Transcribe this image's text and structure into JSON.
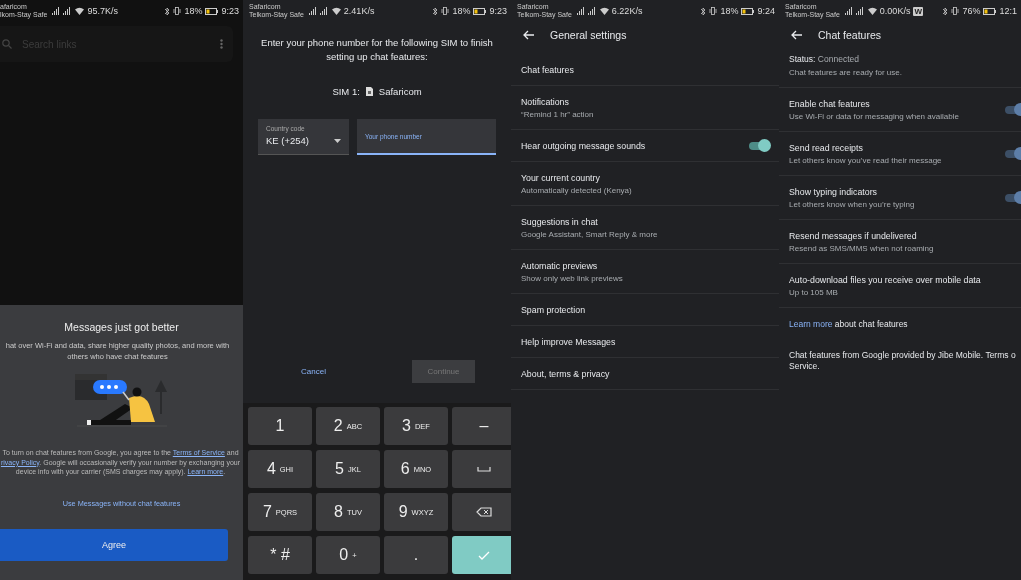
{
  "panels": [
    {
      "kind": "promo",
      "status": {
        "carrier_1": "afaricom",
        "carrier_2": "lkom-Stay Safe",
        "speed": "95.7K/s",
        "battery": "18%",
        "time": "9:23"
      },
      "search": {
        "placeholder": "Search links"
      },
      "sheet": {
        "title": "Messages just got better",
        "subtitle": "hat over Wi-Fi and data, share higher quality photos, and more with others who have chat features",
        "legal": [
          {
            "text": "To turn on chat features from Google, you agree to the ",
            "link": false
          },
          {
            "text": "Terms of Service",
            "link": true
          },
          {
            "text": " and ",
            "link": false
          },
          {
            "text": "rivacy Policy",
            "link": true
          },
          {
            "text": ". Google will occasionally verify your number by exchanging your device info with your carrier (SMS charges may apply). ",
            "link": false
          },
          {
            "text": "Learn more",
            "link": true
          },
          {
            "text": ".",
            "link": false
          }
        ],
        "secondary_button": "Use Messages without chat features",
        "primary_button": "Agree"
      }
    },
    {
      "kind": "verify",
      "status": {
        "carrier_1": "Safaricom",
        "carrier_2": "Telkom-Stay Safe",
        "speed": "2.41K/s",
        "battery": "18%",
        "time": "9:23"
      },
      "prompt": "Enter your phone number for the following SIM to finish setting up chat features:",
      "sim_label": "SIM 1:",
      "sim_name": "Safaricom",
      "country_field": {
        "label": "Country code",
        "value": "KE (+254)"
      },
      "phone_field": {
        "label": "Your phone number",
        "focused": true
      },
      "buttons": [
        {
          "label": "Cancel",
          "disabled": false
        },
        {
          "label": "Continue",
          "disabled": true
        }
      ],
      "keypad": [
        {
          "kind": "digit",
          "label": "1"
        },
        {
          "kind": "digit",
          "label": "2",
          "letters": "ABC"
        },
        {
          "kind": "digit",
          "label": "3",
          "letters": "DEF"
        },
        {
          "kind": "digit",
          "label": "–"
        },
        {
          "kind": "digit",
          "label": "4",
          "letters": "GHI"
        },
        {
          "kind": "digit",
          "label": "5",
          "letters": "JKL"
        },
        {
          "kind": "digit",
          "label": "6",
          "letters": "MNO"
        },
        {
          "kind": "space"
        },
        {
          "kind": "digit",
          "label": "7",
          "letters": "PQRS"
        },
        {
          "kind": "digit",
          "label": "8",
          "letters": "TUV"
        },
        {
          "kind": "digit",
          "label": "9",
          "letters": "WXYZ"
        },
        {
          "kind": "backspace"
        },
        {
          "kind": "digit",
          "label": "* #"
        },
        {
          "kind": "digit",
          "label": "0",
          "letters": "+"
        },
        {
          "kind": "digit",
          "label": "."
        },
        {
          "kind": "enter"
        }
      ]
    },
    {
      "kind": "settings",
      "status": {
        "carrier_1": "Safaricom",
        "carrier_2": "Telkom-Stay Safe",
        "speed": "6.22K/s",
        "battery": "18%",
        "time": "9:24"
      },
      "title": "General settings",
      "items": [
        {
          "kind": "plain",
          "title": "Chat features"
        },
        {
          "kind": "plain",
          "title": "Notifications",
          "subtitle": "“Remind 1 hr” action"
        },
        {
          "kind": "toggle",
          "title": "Hear outgoing message sounds",
          "on": true
        },
        {
          "kind": "plain",
          "title": "Your current country",
          "subtitle": "Automatically detected (Kenya)"
        },
        {
          "kind": "plain",
          "title": "Suggestions in chat",
          "subtitle": "Google Assistant, Smart Reply & more"
        },
        {
          "kind": "plain",
          "title": "Automatic previews",
          "subtitle": "Show only web link previews"
        },
        {
          "kind": "plain",
          "title": "Spam protection"
        },
        {
          "kind": "plain",
          "title": "Help improve Messages"
        },
        {
          "kind": "plain",
          "title": "About, terms & privacy"
        }
      ]
    },
    {
      "kind": "settings",
      "status": {
        "carrier_1": "Safaricom",
        "carrier_2": "Telkom-Stay Safe",
        "speed": "0.00K/s",
        "badge": "W",
        "battery": "76%",
        "time": "12:1"
      },
      "title": "Chat features",
      "state": {
        "label": "Status:",
        "value": "Connected",
        "detail": "Chat features are ready for use."
      },
      "items": [
        {
          "kind": "toggle",
          "title": "Enable chat features",
          "subtitle": "Use Wi-Fi or data for messaging when available",
          "on": true
        },
        {
          "kind": "toggle",
          "title": "Send read receipts",
          "subtitle": "Let others know you’ve read their message",
          "on": true
        },
        {
          "kind": "toggle",
          "title": "Show typing indicators",
          "subtitle": "Let others know when you’re typing",
          "on": true
        },
        {
          "kind": "plain",
          "title": "Resend messages if undelivered",
          "subtitle": "Resend as SMS/MMS when not roaming"
        },
        {
          "kind": "plain",
          "title": "Auto-download files you receive over mobile data",
          "subtitle": "Up to 105 MB"
        }
      ],
      "learn_more": {
        "link": "Learn more",
        "text": " about chat features"
      },
      "footer_lines": [
        "Chat features from Google provided by Jibe Mobile. Terms o",
        "Service."
      ]
    }
  ]
}
